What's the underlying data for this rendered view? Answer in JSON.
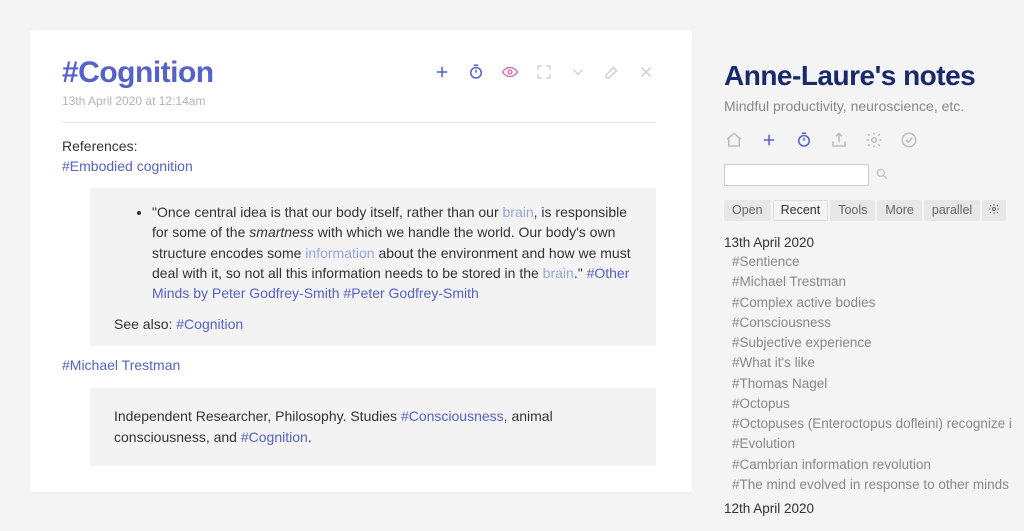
{
  "tiddler": {
    "title": "#Cognition",
    "date": "13th April 2020 at 12:14am",
    "references_label": "References:",
    "ref1": "#Embodied cognition",
    "quote_a": "\"Once central idea is that our body itself, rather than our ",
    "quote_brain1": "brain",
    "quote_b": ", is responsible for some of the ",
    "quote_smartness": "smartness",
    "quote_c": " with which we handle the world. Our body's own structure encodes some ",
    "quote_info": "information",
    "quote_d": " about the environment and how we must deal with it, so not all this information needs to be stored in the ",
    "quote_brain2": "brain",
    "quote_e": ".\" ",
    "tag_book": "#Other Minds by Peter Godfrey-Smith",
    "tag_author": "#Peter Godfrey-Smith",
    "see_also_label": "See also: ",
    "see_also_link": "#Cognition",
    "ref2": "#Michael Trestman",
    "bio_a": "Independent Researcher, Philosophy. Studies ",
    "bio_consciousness": "#Consciousness",
    "bio_b": ", animal consciousness, and ",
    "bio_cognition": "#Cognition",
    "bio_c": "."
  },
  "sidebar": {
    "title": "Anne-Laure's notes",
    "subtitle": "Mindful productivity, neuroscience, etc.",
    "tabs": [
      "Open",
      "Recent",
      "Tools",
      "More",
      "parallel"
    ],
    "selected_tab": 1,
    "recent": [
      {
        "date": "13th April 2020",
        "items": [
          "#Sentience",
          "#Michael Trestman",
          "#Complex active bodies",
          "#Consciousness",
          "#Subjective experience",
          "#What it's like",
          "#Thomas Nagel",
          "#Octopus",
          "#Octopuses (Enteroctopus dofleini) recognize i",
          "#Evolution",
          "#Cambrian information revolution",
          "#The mind evolved in response to other minds"
        ]
      },
      {
        "date": "12th April 2020",
        "items": []
      }
    ]
  }
}
